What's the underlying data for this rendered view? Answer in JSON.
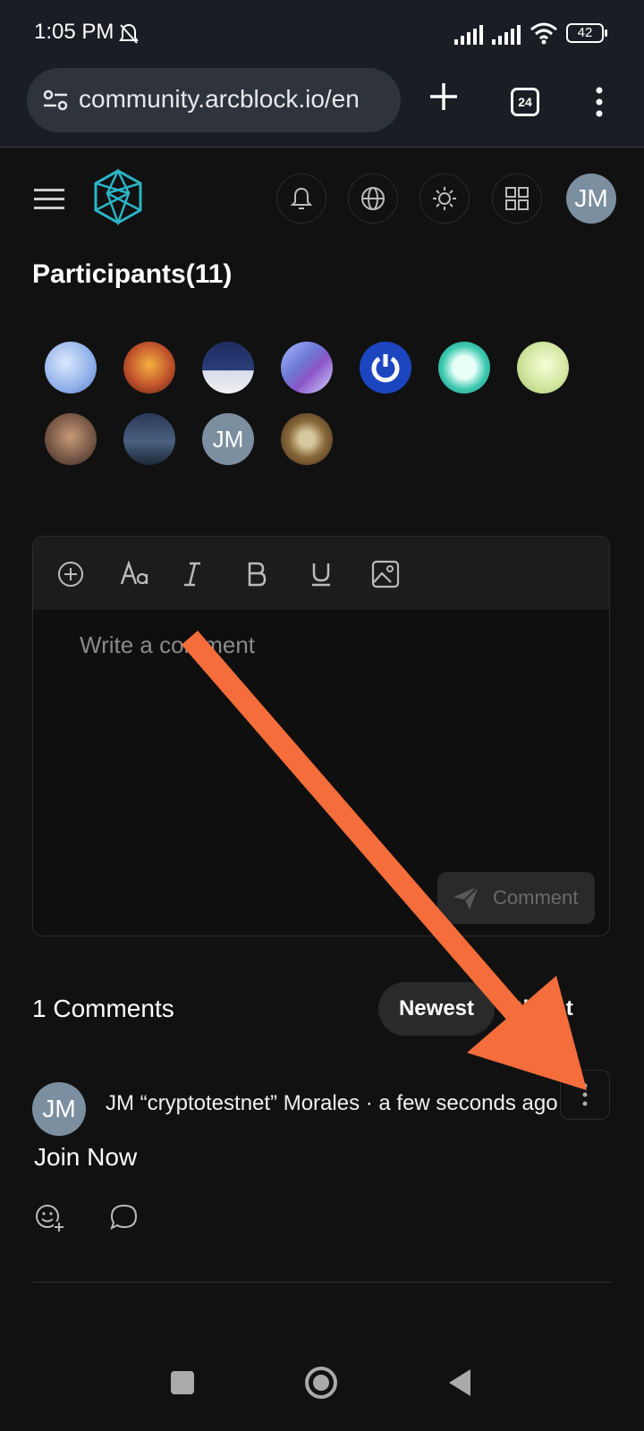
{
  "status_bar": {
    "time": "1:05 PM",
    "battery": "42"
  },
  "browser": {
    "url": "community.arcblock.io/en",
    "tab_count": "24"
  },
  "header": {
    "user_initials": "JM"
  },
  "participants": {
    "title": "Participants(11)",
    "items": [
      {
        "name": "avatar-1",
        "color": "#a9c4ef"
      },
      {
        "name": "avatar-2",
        "color": "#c0532c"
      },
      {
        "name": "avatar-3",
        "color": "#2a3d78"
      },
      {
        "name": "avatar-4",
        "color": "#6c79d6"
      },
      {
        "name": "avatar-5",
        "color": "#1c46c0"
      },
      {
        "name": "avatar-6",
        "color": "#3cc8b0"
      },
      {
        "name": "avatar-7",
        "color": "#d4e8a4"
      },
      {
        "name": "avatar-8",
        "color": "#7a5a48"
      },
      {
        "name": "avatar-9",
        "color": "#34455e"
      },
      {
        "name": "avatar-10",
        "initials": "JM",
        "color": "#7c8fa0"
      },
      {
        "name": "avatar-11",
        "color": "#6a4a2a"
      }
    ]
  },
  "editor": {
    "placeholder": "Write a comment",
    "submit_label": "Comment"
  },
  "comments": {
    "count_label": "1 Comments",
    "sort_newest": "Newest",
    "sort_oldest": "Oldest",
    "items": [
      {
        "author_initials": "JM",
        "meta": "JM “cryptotestnet” Morales · a few seconds ago",
        "body": "Join Now"
      }
    ]
  },
  "colors": {
    "background": "#111111",
    "annotation_arrow": "#f46d3b",
    "avatar_jm": "#7c8fa0",
    "logo_teal": "#2bb5c5"
  }
}
